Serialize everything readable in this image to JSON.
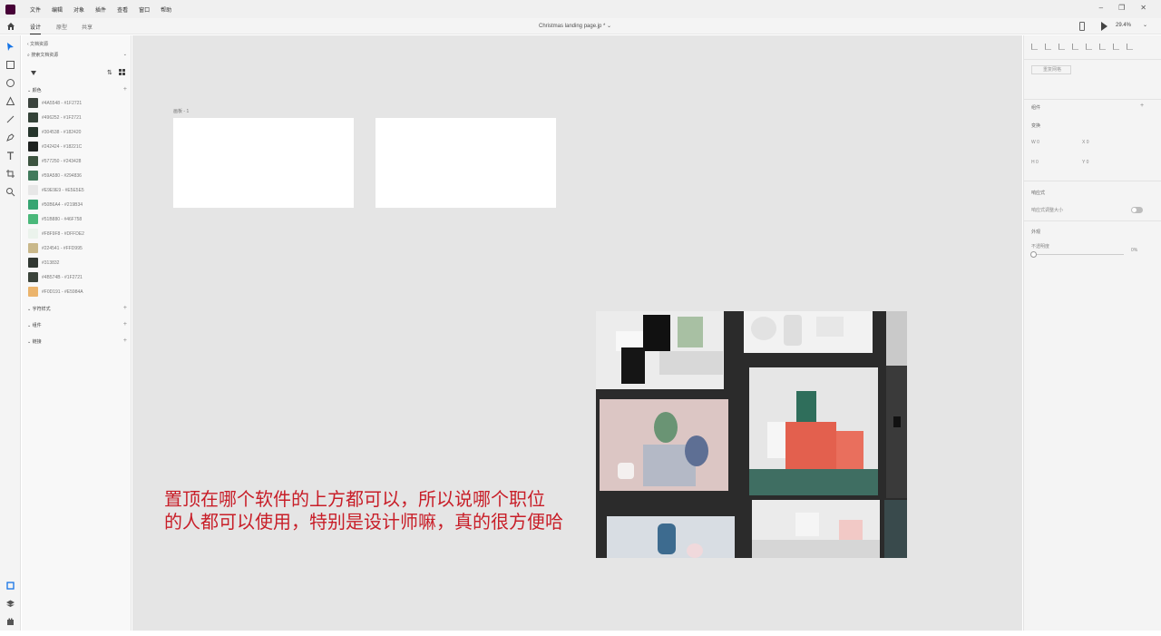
{
  "menubar": {
    "items": [
      "文件",
      "编辑",
      "对象",
      "插件",
      "查看",
      "窗口",
      "帮助"
    ],
    "window_controls": [
      "–",
      "❐",
      "✕"
    ]
  },
  "toolbar": {
    "tabs": [
      "设计",
      "原型",
      "共享"
    ],
    "document_title": "Christmas landing page.jp * ⌄",
    "zoom": "29.4%",
    "zoom_caret": "⌄"
  },
  "assets": {
    "back_label": "‹ 文档资源",
    "search_placeholder": "⌕ 搜索文档资源",
    "search_caret": "⌄",
    "sort_icon_glyph": "⇅",
    "colors_header": "⌄ 颜色",
    "add_glyph": "+",
    "swatches": [
      {
        "label": "#4A5548 - #1F2721",
        "color": "#3b433d"
      },
      {
        "label": "#496252 - #1F2721",
        "color": "#344238"
      },
      {
        "label": "#304538 - #182420",
        "color": "#26352c"
      },
      {
        "label": "#242424 - #18221C",
        "color": "#1e2220"
      },
      {
        "label": "#577250 - #243428",
        "color": "#3d5440"
      },
      {
        "label": "#59A580 - #294836",
        "color": "#417a5c"
      },
      {
        "label": "#E9E9E9 - #E5E5E5",
        "color": "#e7e7e7"
      },
      {
        "label": "#50B6A4 - #219B34",
        "color": "#36a572"
      },
      {
        "label": "#51B880 - #46F758",
        "color": "#4ab87a"
      },
      {
        "label": "#F8F9F8 - #DFFDE2",
        "color": "#ebf3ec"
      },
      {
        "label": "#224541 - #FFD995",
        "color": "#c9b88a"
      },
      {
        "label": "#313832",
        "color": "#313832"
      },
      {
        "label": "#4B574B - #1F2721",
        "color": "#3a433a"
      },
      {
        "label": "#F0D191 - #E5984A",
        "color": "#ebb46c"
      }
    ],
    "char_styles_header": "⌄ 字符样式",
    "components_header": "⌄ 组件",
    "fonts_header": "⌄ 链接"
  },
  "canvas": {
    "artboard_label": "画板 - 1",
    "subtitle_line1": "置顶在哪个软件的上方都可以，所以说哪个职位",
    "subtitle_line2": "的人都可以使用，特别是设计师嘛，真的很方便哈"
  },
  "inspector": {
    "uniform_button": "重复网格",
    "components_label": "组件",
    "layout_label": "变换",
    "w_label": "W  0",
    "x_label": "X  0",
    "h_label": "H  0",
    "y_label": "Y  0",
    "responsive_label": "响应式",
    "responsive_desc": "响应式调整大小",
    "appearance_label": "外观",
    "opacity_label": "不透明度",
    "opacity_value": "0%",
    "add_glyph": "+"
  }
}
